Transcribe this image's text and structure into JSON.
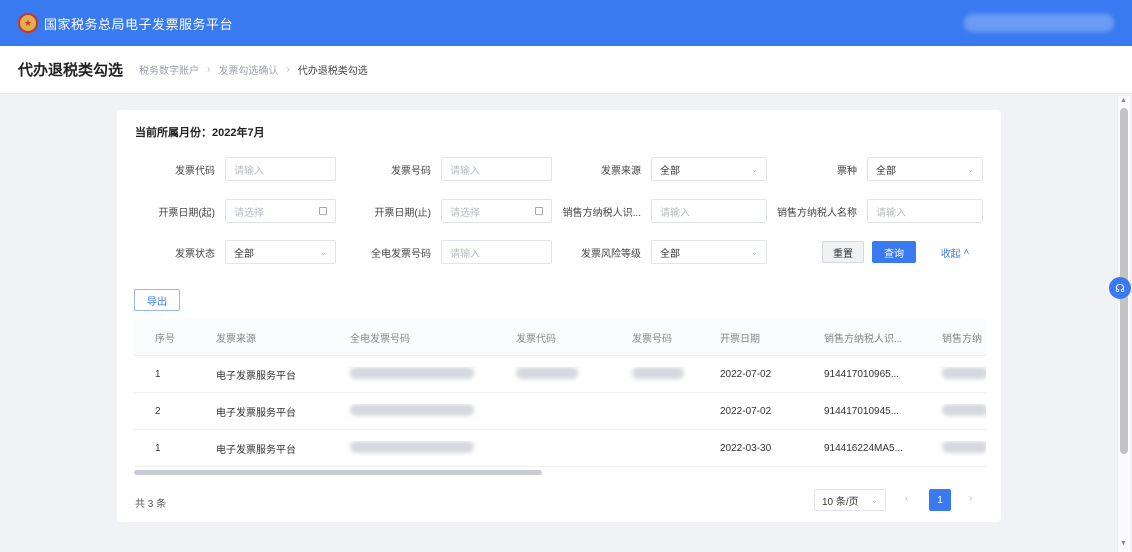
{
  "app": {
    "title": "国家税务总局电子发票服务平台",
    "emblem_icon": "national-emblem"
  },
  "header": {
    "page_title": "代办退税类勾选",
    "breadcrumb": [
      "税务数字账户",
      "发票勾选确认",
      "代办退税类勾选"
    ]
  },
  "filters": {
    "month_label": "当前所属月份：2022年7月",
    "invoice_code": {
      "label": "发票代码",
      "placeholder": "请输入"
    },
    "invoice_number": {
      "label": "发票号码",
      "placeholder": "请输入"
    },
    "invoice_source": {
      "label": "发票来源",
      "value": "全部"
    },
    "tax_type": {
      "label": "票种",
      "value": "全部"
    },
    "date_start": {
      "label": "开票日期(起)",
      "placeholder": "请选择"
    },
    "date_end": {
      "label": "开票日期(止)",
      "placeholder": "请选择"
    },
    "seller_id": {
      "label": "销售方纳税人识...",
      "placeholder": "请输入"
    },
    "seller_name": {
      "label": "销售方纳税人名称",
      "placeholder": "请输入"
    },
    "invoice_status": {
      "label": "发票状态",
      "value": "全部"
    },
    "full_invoice_number": {
      "label": "全电发票号码",
      "placeholder": "请输入"
    },
    "risk_level": {
      "label": "发票风险等级",
      "value": "全部"
    }
  },
  "actions": {
    "reset": "重置",
    "query": "查询",
    "collapse": "收起",
    "export": "导出"
  },
  "table": {
    "headers": [
      "序号",
      "发票来源",
      "全电发票号码",
      "发票代码",
      "发票号码",
      "开票日期",
      "销售方纳税人识...",
      "销售方纳"
    ],
    "rows": [
      {
        "index": "1",
        "source": "电子发票服务平台",
        "date": "2022-07-02",
        "seller": "914417010965..."
      },
      {
        "index": "2",
        "source": "电子发票服务平台",
        "date": "2022-07-02",
        "seller": "914417010945..."
      },
      {
        "index": "1",
        "source": "电子发票服务平台",
        "date": "2022-03-30",
        "seller": "914416224MA5..."
      }
    ]
  },
  "pagination": {
    "total": "共 3 条",
    "page_size": "10 条/页",
    "current": "1"
  },
  "colors": {
    "primary": "#3a7af0",
    "background": "#f0f2f5"
  }
}
